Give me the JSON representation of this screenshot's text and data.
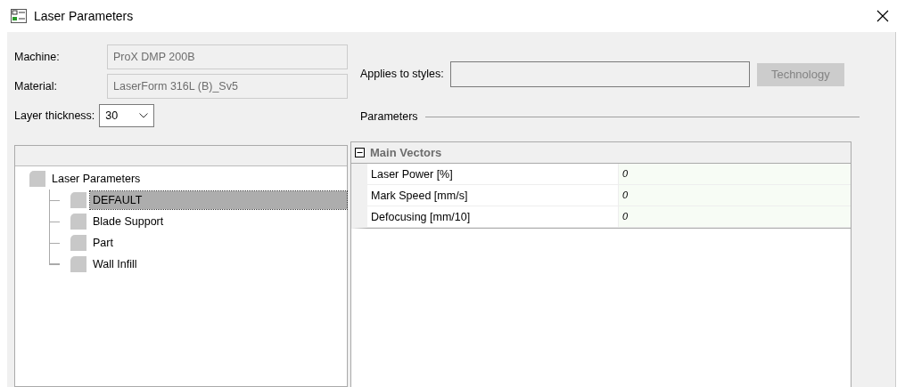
{
  "window": {
    "title": "Laser Parameters"
  },
  "fields": [
    {
      "label": "Machine:",
      "value": "ProX DMP 200B",
      "disabled": true
    },
    {
      "label": "Material:",
      "value": "LaserForm 316L (B)_Sv5",
      "disabled": true
    }
  ],
  "layer_thickness": {
    "label": "Layer thickness:",
    "value": "30"
  },
  "tree": {
    "label": "Laser Parameters",
    "children": [
      {
        "label": "DEFAULT",
        "selected": true
      },
      {
        "label": "Blade Support",
        "selected": false
      },
      {
        "label": "Part",
        "selected": false
      },
      {
        "label": "Wall Infill",
        "selected": false
      }
    ]
  },
  "styles": {
    "label": "Applies to styles:",
    "button": {
      "label": "Technology",
      "disabled": true
    }
  },
  "parameters": {
    "title": "Parameters",
    "groups": [
      {
        "title": "Main Vectors",
        "expanded": true,
        "rows": [
          {
            "name": "Laser Power [%]",
            "value": "0"
          },
          {
            "name": "Mark Speed [mm/s]",
            "value": "0"
          },
          {
            "name": "Defocusing [mm/10]",
            "value": "0"
          }
        ]
      }
    ]
  }
}
